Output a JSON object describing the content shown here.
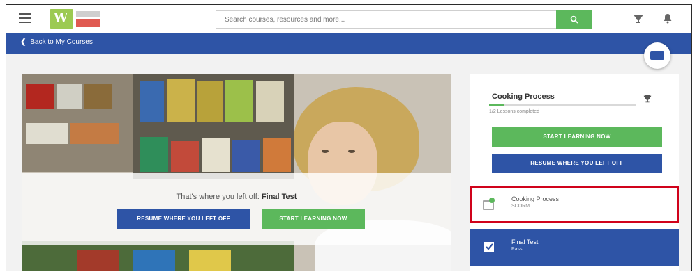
{
  "header": {
    "search_placeholder": "Search courses, resources and more...",
    "icons": [
      "menu-icon",
      "search-icon",
      "trophy-icon",
      "bell-icon"
    ]
  },
  "nav": {
    "back_label": "Back to My Courses"
  },
  "hero": {
    "prompt_text": "That's where you left off:",
    "prompt_item": "Final Test",
    "resume_label": "RESUME WHERE YOU LEFT OFF",
    "start_label": "START LEARNING NOW"
  },
  "panel": {
    "course_title": "Cooking Process",
    "progress_text": "1/2 Lessons completed",
    "progress_fraction": 0.1,
    "start_label": "START LEARNING NOW",
    "resume_label": "RESUME WHERE YOU LEFT OFF",
    "modules": [
      {
        "name": "Cooking Process",
        "status": "SCORM"
      },
      {
        "name": "Final Test",
        "status": "Pass"
      }
    ]
  },
  "colors": {
    "brand_blue": "#2e54a6",
    "green": "#5cb85c",
    "highlight_red": "#d0021b"
  }
}
